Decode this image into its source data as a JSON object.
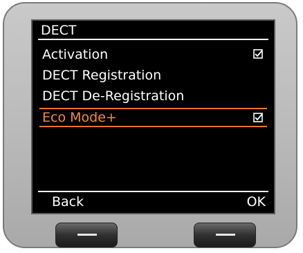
{
  "screen": {
    "title": "DECT",
    "menu_items": [
      {
        "label": "Activation",
        "checked": true
      },
      {
        "label": "DECT Registration",
        "checked": false
      },
      {
        "label": "DECT De-Registration",
        "checked": false
      },
      {
        "label": "Eco Mode+",
        "checked": true
      }
    ],
    "selected_index": 3
  },
  "softkeys": {
    "left_label": "Back",
    "right_label": "OK"
  },
  "colors": {
    "screen_background": "#000000",
    "text": "#ffffff",
    "highlight": "#f08c40",
    "device_body": "#bdbdbd"
  },
  "icons": {
    "checkbox": "checkbox-checked-icon",
    "hardware_key": "dash-icon"
  }
}
